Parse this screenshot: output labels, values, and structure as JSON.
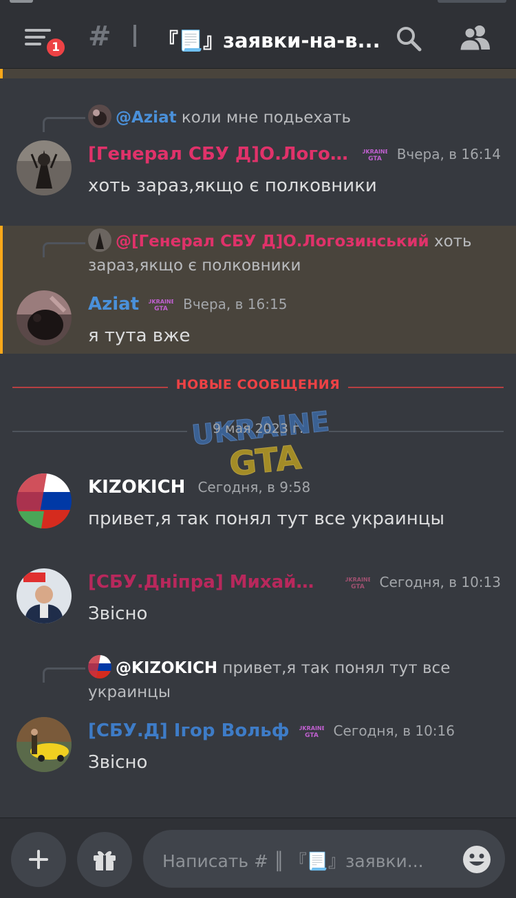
{
  "header": {
    "channel_name": "『📃』заявки-на-в...",
    "notification_count": "1"
  },
  "messages": [
    {
      "reply_mention": "@Aziat",
      "reply_text": " коли мне подьехать",
      "author": "[Генерал СБУ Д]О.Логози...",
      "author_color": "#e0326a",
      "timestamp": "Вчера, в 16:14",
      "content": "хоть зараз,якщо є полковники"
    },
    {
      "reply_mention": "@[Генерал СБУ Д]О.Логозинський",
      "reply_text": " хоть зараз,якщо є полковники",
      "author": "Aziat",
      "author_color": "#4a90d9",
      "timestamp": "Вчера, в 16:15",
      "content": "я тута вже"
    },
    {
      "author": "KIZOKICH",
      "author_color": "#ffffff",
      "timestamp": "Сегодня, в 9:58",
      "content": "привет,я так понял тут все украинцы"
    },
    {
      "author": "[СБУ.Дніпра] Михайло...",
      "author_color": "#b8285c",
      "timestamp": "Сегодня, в 10:13",
      "content": "Звісно"
    },
    {
      "reply_mention": "@KIZOKICH",
      "reply_text": " привет,я так понял тут все украинцы",
      "author": "[СБУ.Д] Ігор Вольф",
      "author_color": "#3e7cc7",
      "timestamp": "Сегодня, в 10:16",
      "content": "Звісно"
    }
  ],
  "separators": {
    "new_messages": "НОВЫЕ СООБЩЕНИЯ",
    "date": "9 мая 2023 г."
  },
  "watermark": {
    "line1": "UKRAINE",
    "line2": "GTA"
  },
  "composer": {
    "placeholder": "Написать # ║ 『📃』заявки..."
  }
}
